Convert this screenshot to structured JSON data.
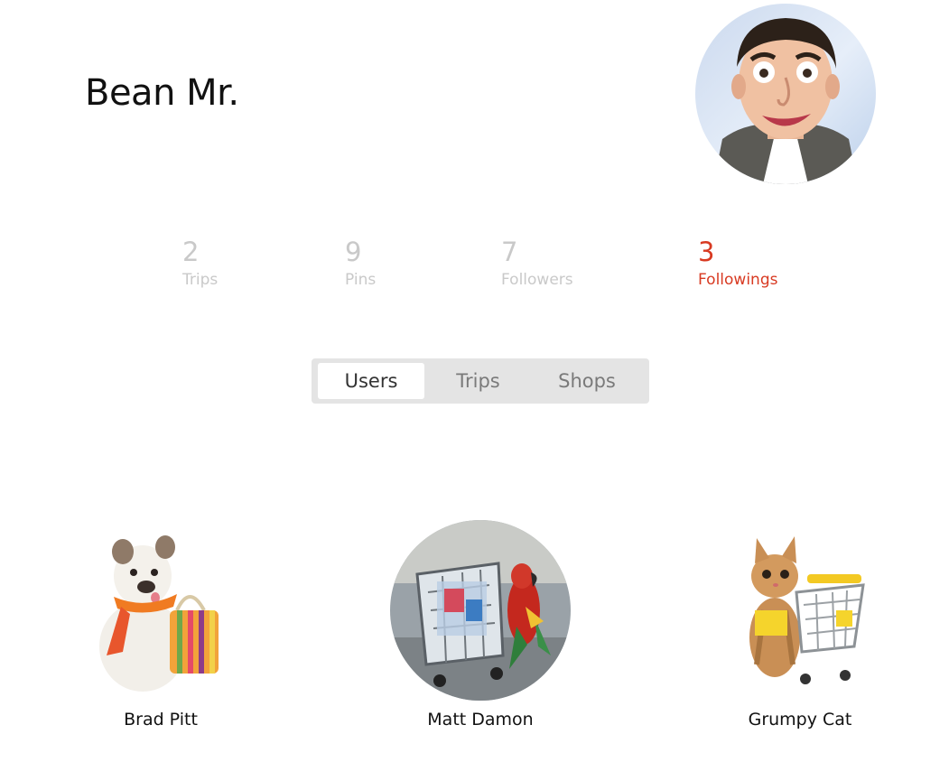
{
  "profile": {
    "name": "Bean Mr.",
    "avatar_icon": "portrait-photo"
  },
  "stats": [
    {
      "value": "2",
      "label": "Trips",
      "active": false
    },
    {
      "value": "9",
      "label": "Pins",
      "active": false
    },
    {
      "value": "7",
      "label": "Followers",
      "active": false
    },
    {
      "value": "3",
      "label": "Followings",
      "active": true
    }
  ],
  "tabs": [
    {
      "label": "Users",
      "active": true
    },
    {
      "label": "Trips",
      "active": false
    },
    {
      "label": "Shops",
      "active": false
    }
  ],
  "users": [
    {
      "name": "Brad Pitt",
      "avatar_icon": "bulldog-with-bag-photo"
    },
    {
      "name": "Matt Damon",
      "avatar_icon": "parrot-with-cart-photo"
    },
    {
      "name": "Grumpy Cat",
      "avatar_icon": "kitten-with-cart-photo"
    }
  ],
  "colors": {
    "accent": "#d83a22",
    "inactive": "#c9c9c9",
    "tab_bar": "#e4e4e4"
  }
}
